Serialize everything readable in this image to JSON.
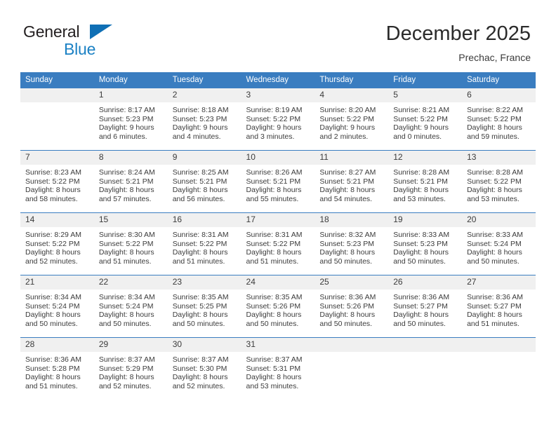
{
  "brand": {
    "name_dark": "General",
    "name_blue": "Blue",
    "triangle_color": "#0f6fb5",
    "blue_color": "#1b81c4"
  },
  "header": {
    "title": "December 2025",
    "location": "Prechac, France"
  },
  "theme": {
    "header_row_bg": "#3a7dc0",
    "header_row_text": "#ffffff",
    "daynum_bg": "#f0f0f0",
    "cell_bg": "#ffffff",
    "text": "#3b3b3b"
  },
  "weekdays": [
    "Sunday",
    "Monday",
    "Tuesday",
    "Wednesday",
    "Thursday",
    "Friday",
    "Saturday"
  ],
  "labels": {
    "sunrise_prefix": "Sunrise:",
    "sunset_prefix": "Sunset:",
    "daylight_prefix": "Daylight:"
  },
  "weeks": [
    [
      {
        "day": "",
        "sunrise": "",
        "sunset": "",
        "daylight": "",
        "empty": true
      },
      {
        "day": "1",
        "sunrise": "Sunrise: 8:17 AM",
        "sunset": "Sunset: 5:23 PM",
        "daylight": "Daylight: 9 hours and 6 minutes."
      },
      {
        "day": "2",
        "sunrise": "Sunrise: 8:18 AM",
        "sunset": "Sunset: 5:23 PM",
        "daylight": "Daylight: 9 hours and 4 minutes."
      },
      {
        "day": "3",
        "sunrise": "Sunrise: 8:19 AM",
        "sunset": "Sunset: 5:22 PM",
        "daylight": "Daylight: 9 hours and 3 minutes."
      },
      {
        "day": "4",
        "sunrise": "Sunrise: 8:20 AM",
        "sunset": "Sunset: 5:22 PM",
        "daylight": "Daylight: 9 hours and 2 minutes."
      },
      {
        "day": "5",
        "sunrise": "Sunrise: 8:21 AM",
        "sunset": "Sunset: 5:22 PM",
        "daylight": "Daylight: 9 hours and 0 minutes."
      },
      {
        "day": "6",
        "sunrise": "Sunrise: 8:22 AM",
        "sunset": "Sunset: 5:22 PM",
        "daylight": "Daylight: 8 hours and 59 minutes."
      }
    ],
    [
      {
        "day": "7",
        "sunrise": "Sunrise: 8:23 AM",
        "sunset": "Sunset: 5:22 PM",
        "daylight": "Daylight: 8 hours and 58 minutes."
      },
      {
        "day": "8",
        "sunrise": "Sunrise: 8:24 AM",
        "sunset": "Sunset: 5:21 PM",
        "daylight": "Daylight: 8 hours and 57 minutes."
      },
      {
        "day": "9",
        "sunrise": "Sunrise: 8:25 AM",
        "sunset": "Sunset: 5:21 PM",
        "daylight": "Daylight: 8 hours and 56 minutes."
      },
      {
        "day": "10",
        "sunrise": "Sunrise: 8:26 AM",
        "sunset": "Sunset: 5:21 PM",
        "daylight": "Daylight: 8 hours and 55 minutes."
      },
      {
        "day": "11",
        "sunrise": "Sunrise: 8:27 AM",
        "sunset": "Sunset: 5:21 PM",
        "daylight": "Daylight: 8 hours and 54 minutes."
      },
      {
        "day": "12",
        "sunrise": "Sunrise: 8:28 AM",
        "sunset": "Sunset: 5:21 PM",
        "daylight": "Daylight: 8 hours and 53 minutes."
      },
      {
        "day": "13",
        "sunrise": "Sunrise: 8:28 AM",
        "sunset": "Sunset: 5:22 PM",
        "daylight": "Daylight: 8 hours and 53 minutes."
      }
    ],
    [
      {
        "day": "14",
        "sunrise": "Sunrise: 8:29 AM",
        "sunset": "Sunset: 5:22 PM",
        "daylight": "Daylight: 8 hours and 52 minutes."
      },
      {
        "day": "15",
        "sunrise": "Sunrise: 8:30 AM",
        "sunset": "Sunset: 5:22 PM",
        "daylight": "Daylight: 8 hours and 51 minutes."
      },
      {
        "day": "16",
        "sunrise": "Sunrise: 8:31 AM",
        "sunset": "Sunset: 5:22 PM",
        "daylight": "Daylight: 8 hours and 51 minutes."
      },
      {
        "day": "17",
        "sunrise": "Sunrise: 8:31 AM",
        "sunset": "Sunset: 5:22 PM",
        "daylight": "Daylight: 8 hours and 51 minutes."
      },
      {
        "day": "18",
        "sunrise": "Sunrise: 8:32 AM",
        "sunset": "Sunset: 5:23 PM",
        "daylight": "Daylight: 8 hours and 50 minutes."
      },
      {
        "day": "19",
        "sunrise": "Sunrise: 8:33 AM",
        "sunset": "Sunset: 5:23 PM",
        "daylight": "Daylight: 8 hours and 50 minutes."
      },
      {
        "day": "20",
        "sunrise": "Sunrise: 8:33 AM",
        "sunset": "Sunset: 5:24 PM",
        "daylight": "Daylight: 8 hours and 50 minutes."
      }
    ],
    [
      {
        "day": "21",
        "sunrise": "Sunrise: 8:34 AM",
        "sunset": "Sunset: 5:24 PM",
        "daylight": "Daylight: 8 hours and 50 minutes."
      },
      {
        "day": "22",
        "sunrise": "Sunrise: 8:34 AM",
        "sunset": "Sunset: 5:24 PM",
        "daylight": "Daylight: 8 hours and 50 minutes."
      },
      {
        "day": "23",
        "sunrise": "Sunrise: 8:35 AM",
        "sunset": "Sunset: 5:25 PM",
        "daylight": "Daylight: 8 hours and 50 minutes."
      },
      {
        "day": "24",
        "sunrise": "Sunrise: 8:35 AM",
        "sunset": "Sunset: 5:26 PM",
        "daylight": "Daylight: 8 hours and 50 minutes."
      },
      {
        "day": "25",
        "sunrise": "Sunrise: 8:36 AM",
        "sunset": "Sunset: 5:26 PM",
        "daylight": "Daylight: 8 hours and 50 minutes."
      },
      {
        "day": "26",
        "sunrise": "Sunrise: 8:36 AM",
        "sunset": "Sunset: 5:27 PM",
        "daylight": "Daylight: 8 hours and 50 minutes."
      },
      {
        "day": "27",
        "sunrise": "Sunrise: 8:36 AM",
        "sunset": "Sunset: 5:27 PM",
        "daylight": "Daylight: 8 hours and 51 minutes."
      }
    ],
    [
      {
        "day": "28",
        "sunrise": "Sunrise: 8:36 AM",
        "sunset": "Sunset: 5:28 PM",
        "daylight": "Daylight: 8 hours and 51 minutes."
      },
      {
        "day": "29",
        "sunrise": "Sunrise: 8:37 AM",
        "sunset": "Sunset: 5:29 PM",
        "daylight": "Daylight: 8 hours and 52 minutes."
      },
      {
        "day": "30",
        "sunrise": "Sunrise: 8:37 AM",
        "sunset": "Sunset: 5:30 PM",
        "daylight": "Daylight: 8 hours and 52 minutes."
      },
      {
        "day": "31",
        "sunrise": "Sunrise: 8:37 AM",
        "sunset": "Sunset: 5:31 PM",
        "daylight": "Daylight: 8 hours and 53 minutes."
      },
      {
        "day": "",
        "sunrise": "",
        "sunset": "",
        "daylight": "",
        "empty": true
      },
      {
        "day": "",
        "sunrise": "",
        "sunset": "",
        "daylight": "",
        "empty": true
      },
      {
        "day": "",
        "sunrise": "",
        "sunset": "",
        "daylight": "",
        "empty": true
      }
    ]
  ]
}
